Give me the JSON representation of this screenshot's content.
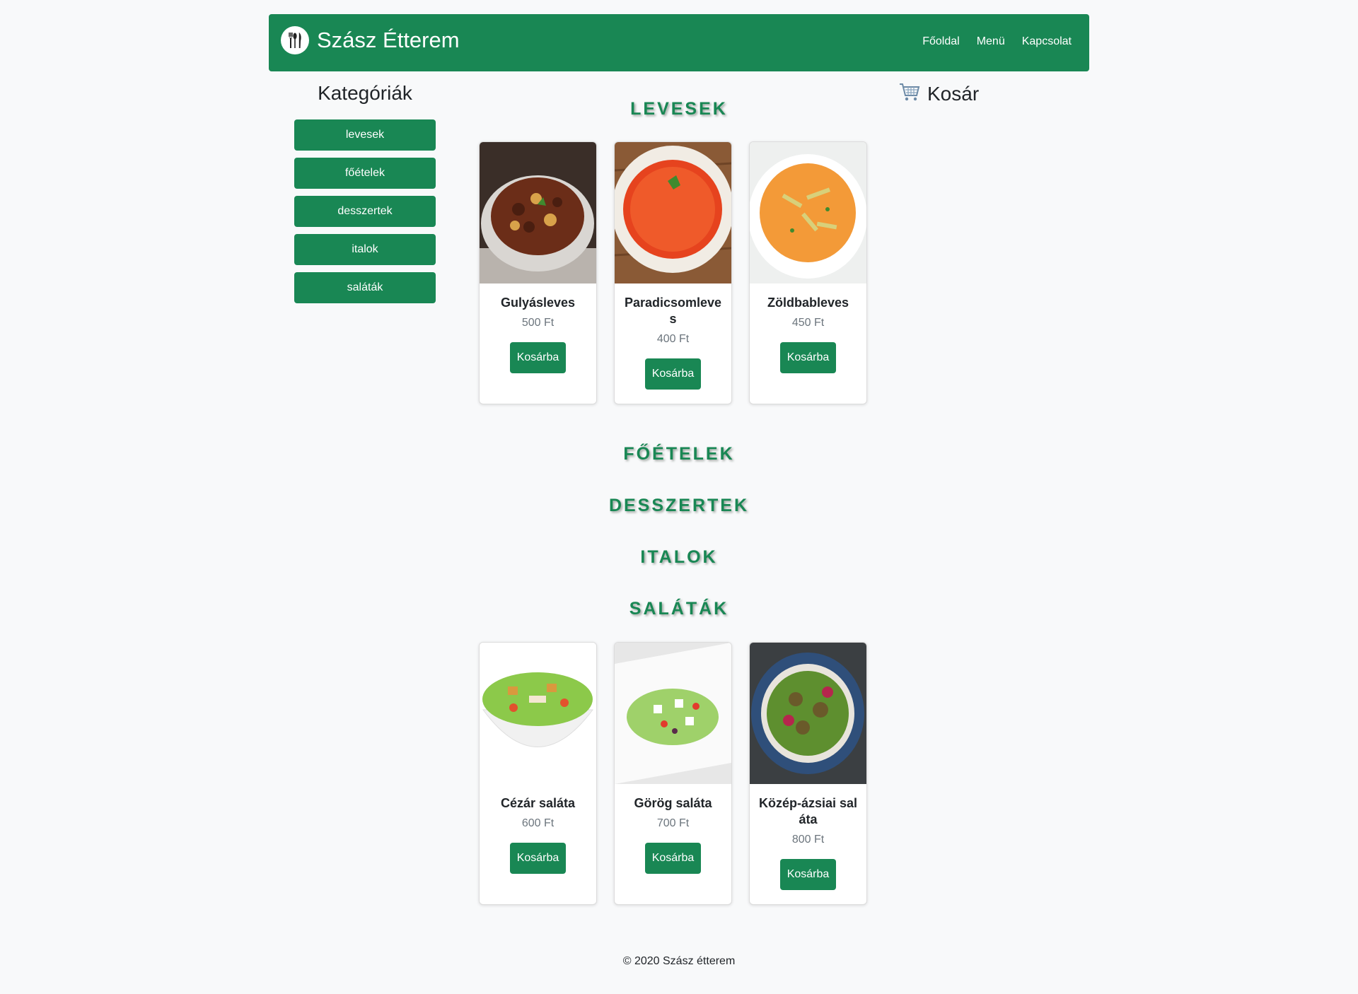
{
  "brand": {
    "title": "Szász Étterem"
  },
  "nav": {
    "links": [
      "Főoldal",
      "Menü",
      "Kapcsolat"
    ]
  },
  "sidebar": {
    "title": "Kategóriák",
    "categories": [
      "levesek",
      "főételek",
      "desszertek",
      "italok",
      "saláták"
    ]
  },
  "cart": {
    "title": "Kosár"
  },
  "sections": {
    "levesek": {
      "heading": "LEVESEK",
      "items": [
        {
          "name": "Gulyásleves",
          "price": "500 Ft",
          "button": "Kosárba"
        },
        {
          "name": "Paradicsomleves",
          "price": "400 Ft",
          "button": "Kosárba"
        },
        {
          "name": "Zöldbableves",
          "price": "450 Ft",
          "button": "Kosárba"
        }
      ]
    },
    "foetelek": {
      "heading": "FŐÉTELEK"
    },
    "desszertek": {
      "heading": "DESSZERTEK"
    },
    "italok": {
      "heading": "ITALOK"
    },
    "salatak": {
      "heading": "SALÁTÁK",
      "items": [
        {
          "name": "Cézár saláta",
          "price": "600 Ft",
          "button": "Kosárba"
        },
        {
          "name": "Görög saláta",
          "price": "700 Ft",
          "button": "Kosárba"
        },
        {
          "name": "Közép-ázsiai saláta",
          "price": "800 Ft",
          "button": "Kosárba"
        }
      ]
    }
  },
  "footer": {
    "text": "© 2020 Szász étterem"
  },
  "colors": {
    "primary": "#198754",
    "background": "#f8f9fa",
    "muted": "#6c757d"
  }
}
